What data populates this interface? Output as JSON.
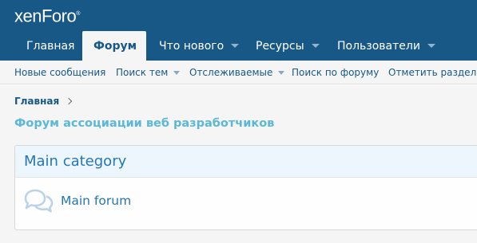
{
  "header": {
    "logo_text": "xenForo",
    "logo_mark": "®"
  },
  "nav": {
    "tabs": [
      {
        "label": "Главная",
        "selected": false,
        "has_menu": false
      },
      {
        "label": "Форум",
        "selected": true,
        "has_menu": false
      },
      {
        "label": "Что нового",
        "selected": false,
        "has_menu": true
      },
      {
        "label": "Ресурсы",
        "selected": false,
        "has_menu": true
      },
      {
        "label": "Пользователи",
        "selected": false,
        "has_menu": true
      }
    ]
  },
  "subnav": {
    "items": [
      {
        "label": "Новые сообщения",
        "has_menu": false
      },
      {
        "label": "Поиск тем",
        "has_menu": true
      },
      {
        "label": "Отслеживаемые",
        "has_menu": true
      },
      {
        "label": "Поиск по форуму",
        "has_menu": false
      },
      {
        "label": "Отметить разделы",
        "has_menu": false
      }
    ]
  },
  "breadcrumb": {
    "items": [
      "Главная"
    ]
  },
  "page": {
    "title": "Форум ассоциации веб разработчиков"
  },
  "category": {
    "title": "Main category",
    "nodes": [
      {
        "title": "Main forum",
        "icon": "speech-bubbles-icon"
      }
    ]
  },
  "colors": {
    "header_bg": "#185886",
    "accent": "#2577b1",
    "title": "#5cb8d6",
    "page_bg": "#f5f5f5"
  }
}
